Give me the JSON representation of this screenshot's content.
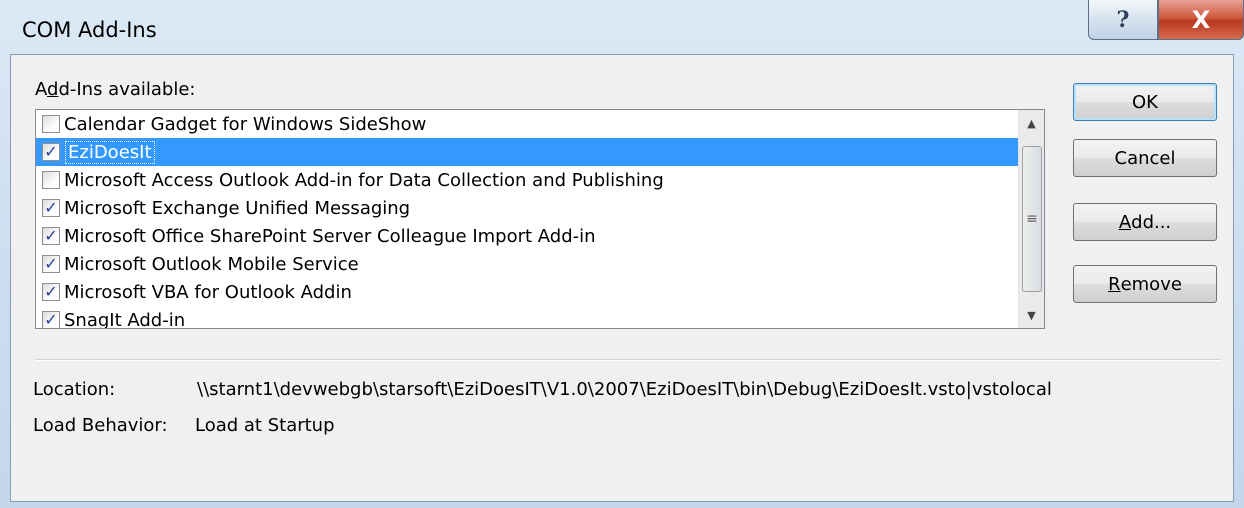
{
  "window": {
    "title": "COM Add-Ins",
    "help_glyph": "?",
    "close_glyph": "X"
  },
  "addins": {
    "label_prefix": "A",
    "label_accel": "d",
    "label_suffix": "d-Ins available:",
    "items": [
      {
        "label": "Calendar Gadget for Windows SideShow",
        "checked": false,
        "selected": false
      },
      {
        "label": "EziDoesIt",
        "checked": true,
        "selected": true
      },
      {
        "label": "Microsoft Access Outlook Add-in for Data Collection and Publishing",
        "checked": false,
        "selected": false
      },
      {
        "label": "Microsoft Exchange Unified Messaging",
        "checked": true,
        "selected": false
      },
      {
        "label": "Microsoft Office SharePoint Server Colleague Import Add-in",
        "checked": true,
        "selected": false
      },
      {
        "label": "Microsoft Outlook Mobile Service",
        "checked": true,
        "selected": false
      },
      {
        "label": "Microsoft VBA for Outlook Addin",
        "checked": true,
        "selected": false
      },
      {
        "label": "SnagIt Add-in",
        "checked": true,
        "selected": false
      }
    ],
    "check_glyph": "✓"
  },
  "buttons": {
    "ok": "OK",
    "cancel": "Cancel",
    "add_accel": "A",
    "add_rest": "dd...",
    "remove_accel": "R",
    "remove_rest": "emove"
  },
  "details": {
    "location_label": "Location:",
    "location_value": "\\\\starnt1\\devwebgb\\starsoft\\EziDoesIT\\V1.0\\2007\\EziDoesIT\\bin\\Debug\\EziDoesIt.vsto|vstolocal",
    "load_behavior_label": "Load Behavior:",
    "load_behavior_value": "Load at Startup"
  }
}
